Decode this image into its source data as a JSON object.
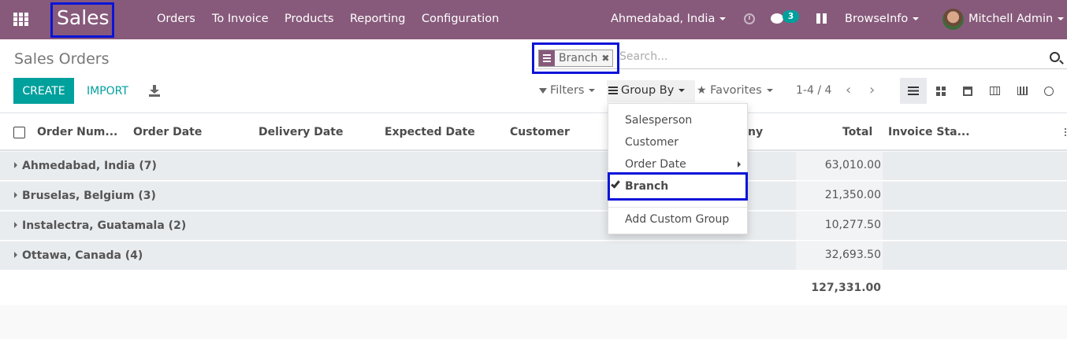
{
  "navbar": {
    "brand": "Sales",
    "menu": [
      "Orders",
      "To Invoice",
      "Products",
      "Reporting",
      "Configuration"
    ],
    "company_switch": "Ahmedabad, India",
    "messages_count": "3",
    "company": "BrowseInfo",
    "user": "Mitchell Admin",
    "accent_color": "#875a7b"
  },
  "control": {
    "breadcrumb": "Sales Orders",
    "facet_label": "Branch",
    "search_placeholder": "Search...",
    "create_label": "CREATE",
    "import_label": "IMPORT",
    "filters_label": "Filters",
    "groupby_label": "Group By",
    "favorites_label": "Favorites",
    "pager": "1-4 / 4",
    "primary_color": "#00a09d"
  },
  "table": {
    "columns": [
      "Order Num...",
      "Order Date",
      "Delivery Date",
      "Expected Date",
      "Customer",
      "ny",
      "Total",
      "Invoice Sta..."
    ],
    "groups": [
      {
        "name": "Ahmedabad, India (7)",
        "total": "63,010.00"
      },
      {
        "name": "Bruselas, Belgium (3)",
        "total": "21,350.00"
      },
      {
        "name": "Instalectra, Guatamala (2)",
        "total": "10,277.50"
      },
      {
        "name": "Ottawa, Canada (4)",
        "total": "32,693.50"
      }
    ],
    "grand_total": "127,331.00"
  },
  "groupby_menu": {
    "items": [
      "Salesperson",
      "Customer",
      "Order Date",
      "Branch"
    ],
    "selected": "Branch",
    "custom": "Add Custom Group"
  },
  "highlight_color": "#0a14d8"
}
